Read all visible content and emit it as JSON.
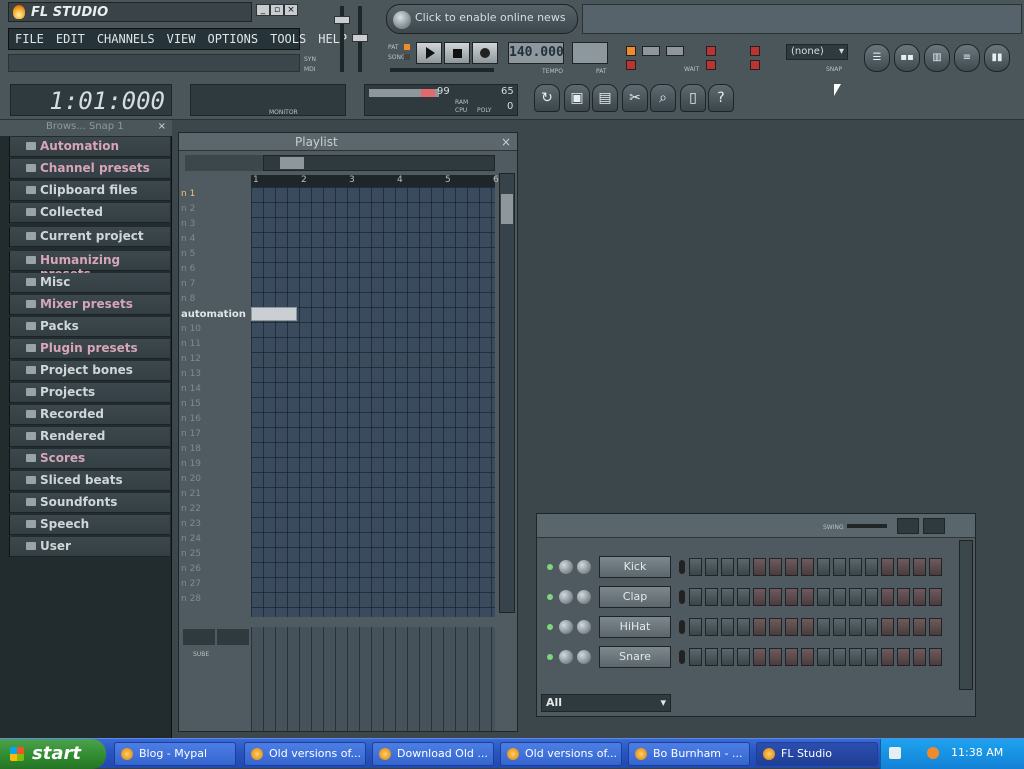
{
  "app": {
    "name": "FL STUDIO",
    "menu": [
      "FILE",
      "EDIT",
      "CHANNELS",
      "VIEW",
      "OPTIONS",
      "TOOLS",
      "HELP"
    ],
    "news_text": "Click to enable online news",
    "tempo": "140.000",
    "tempo_label": "TEMPO",
    "pat_label": "PAT",
    "pattern_select": "(none)",
    "snap_label": "SNAP",
    "time": "1:01:000",
    "monitor_label": "MONITOR",
    "cpu_label": "CPU",
    "ram_label": "RAM",
    "poly_label": "POLY",
    "cpu_value": "99",
    "poly_value": "65",
    "ram_value": "0",
    "syn_label": "SYN",
    "mdi_label": "MDI",
    "pat_mode": "PAT",
    "song_mode": "SONG",
    "wait_label": "WAIT"
  },
  "browser": {
    "title": "Brows... Snap 1",
    "items": [
      {
        "label": "Automation",
        "pink": true
      },
      {
        "label": "Channel presets",
        "pink": true
      },
      {
        "label": "Clipboard files",
        "pink": false
      },
      {
        "label": "Collected",
        "pink": false
      },
      {
        "label": "Current project",
        "pink": false
      },
      {
        "label": "Humanizing presets",
        "pink": true
      },
      {
        "label": "Misc",
        "pink": false
      },
      {
        "label": "Mixer presets",
        "pink": true
      },
      {
        "label": "Packs",
        "pink": false
      },
      {
        "label": "Plugin presets",
        "pink": true
      },
      {
        "label": "Project bones",
        "pink": false
      },
      {
        "label": "Projects",
        "pink": false
      },
      {
        "label": "Recorded",
        "pink": false
      },
      {
        "label": "Rendered",
        "pink": false
      },
      {
        "label": "Scores",
        "pink": true
      },
      {
        "label": "Sliced beats",
        "pink": false
      },
      {
        "label": "Soundfonts",
        "pink": false
      },
      {
        "label": "Speech",
        "pink": false
      },
      {
        "label": "User",
        "pink": false
      }
    ]
  },
  "playlist": {
    "title": "Playlist",
    "ruler": [
      "1",
      "2",
      "3",
      "4",
      "5",
      "6"
    ],
    "tracks": [
      "n 1",
      "n 2",
      "n 3",
      "n 4",
      "n 5",
      "n 6",
      "n 7",
      "n 8",
      "automation",
      "n 10",
      "n 11",
      "n 12",
      "n 13",
      "n 14",
      "n 15",
      "n 16",
      "n 17",
      "n 18",
      "n 19",
      "n 20",
      "n 21",
      "n 22",
      "n 23",
      "n 24",
      "n 25",
      "n 26",
      "n 27",
      "n 28"
    ],
    "sub_label": "SUBE"
  },
  "stepseq": {
    "swing_label": "SWING",
    "channels": [
      "Kick",
      "Clap",
      "HiHat",
      "Snare"
    ],
    "filter": "All"
  },
  "taskbar": {
    "start": "start",
    "tasks": [
      "Blog - Mypal",
      "Old versions of...",
      "Download Old ...",
      "Old versions of...",
      "Bo Burnham - ...",
      "FL Studio"
    ],
    "clock": "11:38 AM"
  }
}
